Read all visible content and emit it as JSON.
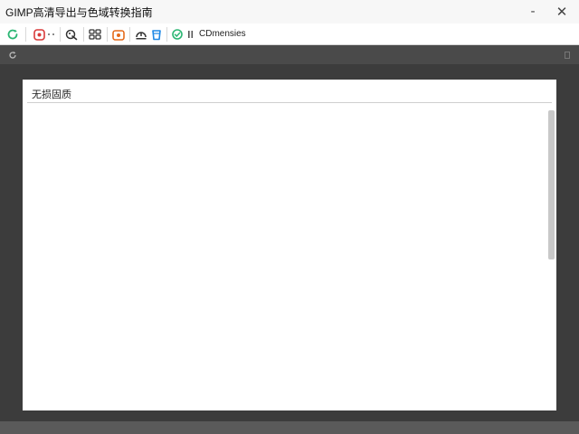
{
  "window": {
    "title": "GIMP高清导出与色域转换指南",
    "minimize_label": "-",
    "close_label": "✕"
  },
  "toolbar": {
    "label": "CDmensies",
    "icons": [
      "refresh-icon",
      "record-icon",
      "dots-icon",
      "paint-icon",
      "layers-icon",
      "camera-icon",
      "eject-icon",
      "bucket-icon",
      "check-icon",
      "pause-icon"
    ],
    "colors": {
      "green": "#2bb673",
      "red": "#d93a3a",
      "orange": "#e56a1a",
      "blue": "#1e88e5"
    }
  },
  "panel": {
    "title": "无损固质"
  }
}
